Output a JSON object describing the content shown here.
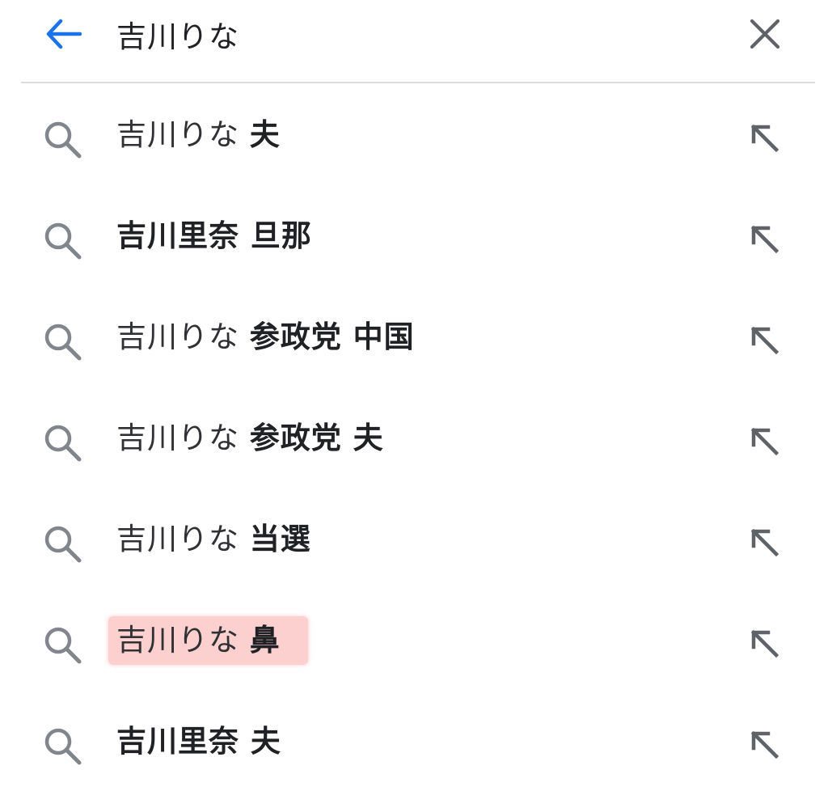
{
  "search": {
    "query": "吉川りな",
    "back_icon": "arrow-left-icon",
    "clear_icon": "close-icon",
    "accent_color": "#1a73e8"
  },
  "suggestions": [
    {
      "prefix": "吉川りな ",
      "suffix": "夫",
      "highlighted": false
    },
    {
      "prefix": "",
      "suffix": "吉川里奈 旦那",
      "highlighted": false
    },
    {
      "prefix": "吉川りな ",
      "suffix": "参政党 中国",
      "highlighted": false
    },
    {
      "prefix": "吉川りな ",
      "suffix": "参政党 夫",
      "highlighted": false
    },
    {
      "prefix": "吉川りな ",
      "suffix": "当選",
      "highlighted": false
    },
    {
      "prefix": "吉川りな ",
      "suffix": "鼻",
      "highlighted": true,
      "highlight_color": "#f8a5a5"
    },
    {
      "prefix": "",
      "suffix": "吉川里奈 夫",
      "highlighted": false
    }
  ],
  "row_icons": {
    "left": "search-icon",
    "right": "fill-query-arrow-icon"
  }
}
